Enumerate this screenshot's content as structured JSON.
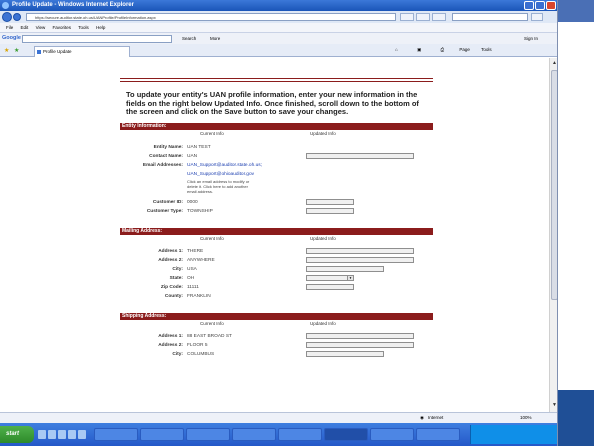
{
  "window": {
    "title": "Profile Update - Windows Internet Explorer",
    "url": "https://secure.auditor.state.oh.us/UANProfile/ProfileInformation.aspx",
    "tab_label": "Profile Update"
  },
  "menu": [
    "File",
    "Edit",
    "View",
    "Favorites",
    "Tools",
    "Help"
  ],
  "google_bar": {
    "logo": "Google",
    "search_label": "Search",
    "more_label": "More",
    "signin_label": "Sign In"
  },
  "toolbar_right": {
    "page_label": "Page",
    "tools_label": "Tools"
  },
  "status_bar": {
    "zone": "Internet",
    "zoom": "100%"
  },
  "taskbar": {
    "start_label": "start",
    "tasks": [
      "",
      "",
      "",
      "",
      "",
      "",
      "",
      ""
    ],
    "clock": ""
  },
  "colors": {
    "section_header": "#8b1c1c",
    "accent_blue": "#1f4f96"
  },
  "form": {
    "intro": "To update your entity's UAN profile information, enter your new information in the fields on the right below Updated Info. Once finished, scroll down to the bottom of the screen and click on the Save button to save your changes.",
    "col_current": "Current Info",
    "col_updated": "Updated Info",
    "entity": {
      "header": "Entity Information:",
      "entity_name_label": "Entity Name:",
      "entity_name_value": "UAN TEST",
      "contact_name_label": "Contact Name:",
      "contact_name_value": "UAN",
      "email_label": "Email Addresses:",
      "email_1": "UAN_Support@auditor.state.oh.us;",
      "email_2": "UAN_Support@ohioauditor.gov",
      "email_note": "Click an email address to modify or delete it. Click here to add another email address.",
      "customer_id_label": "Customer ID:",
      "customer_id_value": "0000",
      "customer_type_label": "Customer Type:",
      "customer_type_value": "TOWNSHIP"
    },
    "mailing": {
      "header": "Mailing Address:",
      "address1_label": "Address 1:",
      "address1_value": "THERE",
      "address2_label": "Address 2:",
      "address2_value": "ANYWHERE",
      "city_label": "City:",
      "city_value": "USA",
      "state_label": "State:",
      "state_value": "OH",
      "zip_label": "Zip Code:",
      "zip_value": "11111",
      "county_label": "County:",
      "county_value": "FRANKLIN"
    },
    "shipping": {
      "header": "Shipping Address:",
      "address1_label": "Address 1:",
      "address1_value": "88 EAST BROAD ST",
      "address2_label": "Address 2:",
      "address2_value": "FLOOR 5",
      "city_label": "City:",
      "city_value": "COLUMBUS"
    }
  }
}
